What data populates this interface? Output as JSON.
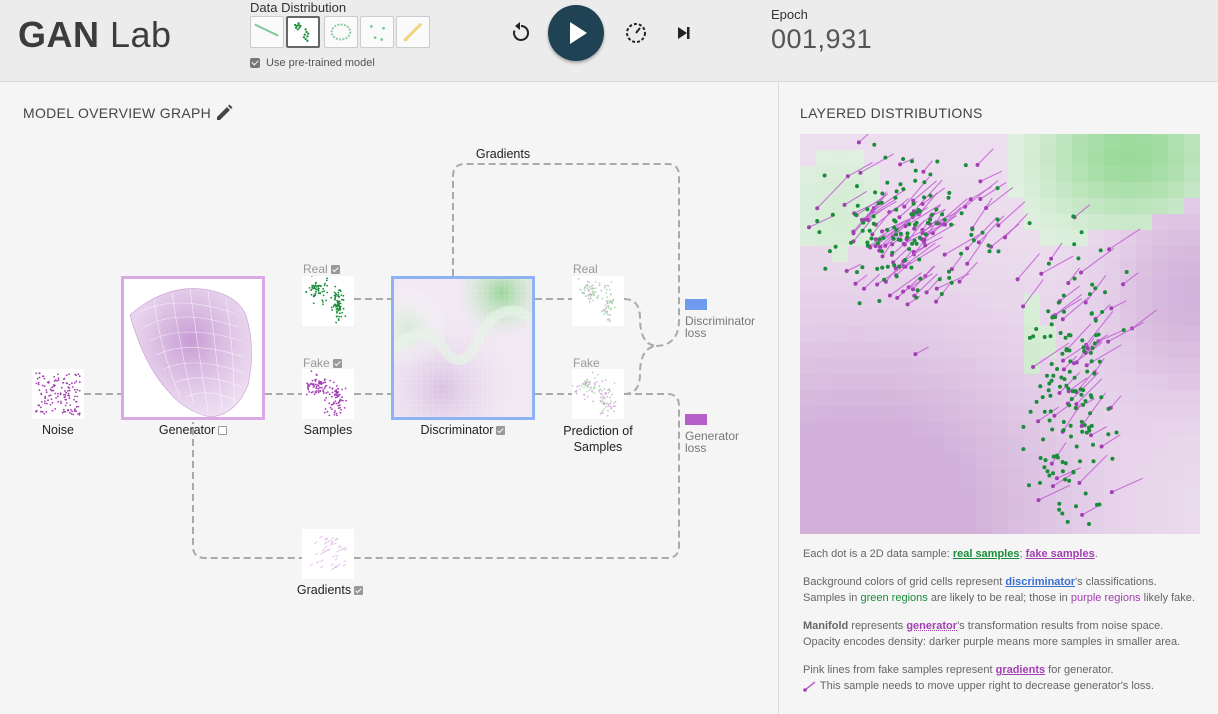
{
  "app": {
    "title_bold": "GAN",
    "title_light": "Lab"
  },
  "data_distribution": {
    "title": "Data Distribution",
    "options": [
      {
        "icon": "line-distribution-icon",
        "selected": false
      },
      {
        "icon": "two-gaussian-clusters-icon",
        "selected": true
      },
      {
        "icon": "ring-distribution-icon",
        "selected": false
      },
      {
        "icon": "scattered-points-icon",
        "selected": false
      },
      {
        "icon": "draw-distribution-brush-icon",
        "selected": false
      }
    ],
    "pretrained_label": "Use pre-trained model",
    "pretrained_checked": true
  },
  "controls": {
    "reset_icon": "reset-icon",
    "play_icon": "play-icon",
    "slow_icon": "slow-motion-icon",
    "step_icon": "step-forward-icon"
  },
  "epoch": {
    "label": "Epoch",
    "value": "001,931"
  },
  "graph": {
    "title": "MODEL OVERVIEW GRAPH",
    "nodes": {
      "noise": "Noise",
      "generator": "Generator",
      "samples": "Samples",
      "discriminator": "Discriminator",
      "prediction_line1": "Prediction of",
      "prediction_line2": "Samples",
      "gradients_bottom": "Gradients"
    },
    "sub_labels": {
      "real_samples": "Real",
      "fake_samples": "Fake",
      "real_prediction": "Real",
      "fake_prediction": "Fake",
      "gradients_top": "Gradients"
    },
    "losses": {
      "discriminator_line1": "Discriminator",
      "discriminator_line2": "loss",
      "generator_line1": "Generator",
      "generator_line2": "loss"
    },
    "colors": {
      "discriminator_loss": "#6e9bf0",
      "generator_loss": "#b65fc9",
      "generator_border": "#dba8e6",
      "discriminator_border": "#8eb3f5"
    }
  },
  "layered": {
    "title": "LAYERED DISTRIBUTIONS",
    "legend": {
      "line1_prefix": "Each dot is a 2D data sample: ",
      "real_samples": "real samples",
      "sep": "; ",
      "fake_samples": "fake samples",
      "line1_suffix": ".",
      "line2_prefix": "Background colors of grid cells represent ",
      "discriminator": "discriminator",
      "line2_suffix": "'s classifications.",
      "line3_prefix": "Samples in ",
      "green_regions": "green regions",
      "line3_mid": " are likely to be real; those in ",
      "purple_regions": "purple regions",
      "line3_suffix": " likely fake.",
      "manifold": "Manifold",
      "line4_mid": " represents ",
      "generator": "generator",
      "line4_suffix": "'s transformation results from noise space.",
      "line5": "Opacity encodes density: darker purple means more samples in smaller area.",
      "line6_prefix": "Pink lines from fake samples represent ",
      "gradients": "gradients",
      "line6_suffix": " for generator.",
      "line7": "This sample needs to move upper right to decrease generator's loss."
    },
    "colors": {
      "real": "#1a8c3a",
      "fake": "#a23fb2",
      "green_region": "#9fdb9f",
      "purple_region": "#d9bde0"
    }
  }
}
